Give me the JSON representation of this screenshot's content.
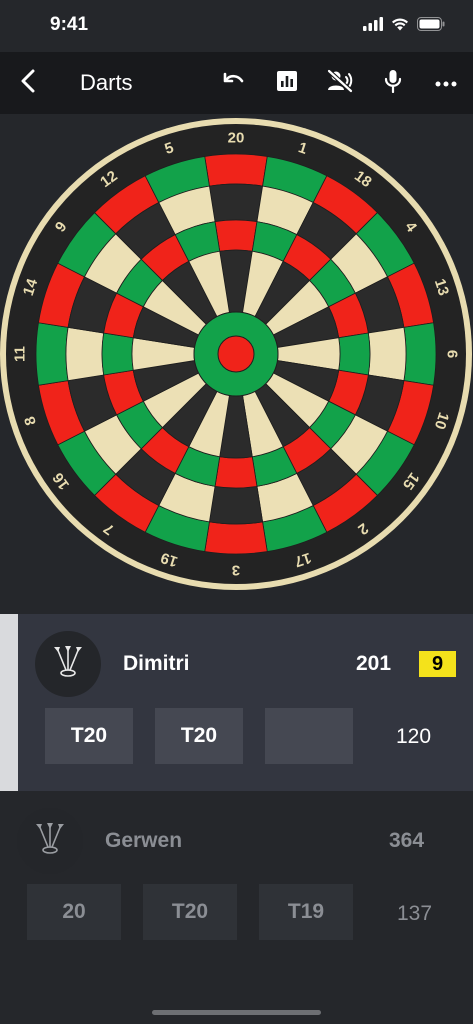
{
  "status": {
    "time": "9:41",
    "icons": [
      "signal-icon",
      "wifi-icon",
      "battery-icon"
    ]
  },
  "nav": {
    "title": "Darts",
    "icons": [
      "back-arrow-icon",
      "undo-icon",
      "stats-icon",
      "voice-off-icon",
      "microphone-icon",
      "more-icon"
    ]
  },
  "board": {
    "numbers": [
      "20",
      "1",
      "18",
      "4",
      "13",
      "6",
      "10",
      "15",
      "2",
      "17",
      "3",
      "19",
      "7",
      "16",
      "8",
      "11",
      "14",
      "9",
      "12",
      "5"
    ],
    "colors": {
      "black": "#2b2b2b",
      "cream": "#ece0b5",
      "red": "#f0231a",
      "green": "#12a24a",
      "rim": "#232323",
      "wire": "#e8dcb0",
      "numbers": "#e8dcb0"
    }
  },
  "players": [
    {
      "name": "Dimitri",
      "score": "201",
      "darts_left": "9",
      "active": true,
      "throws": [
        "T20",
        "T20",
        ""
      ],
      "turn_total": "120",
      "avatar_icon": "darts-icon"
    },
    {
      "name": "Gerwen",
      "score": "364",
      "active": false,
      "throws": [
        "20",
        "T20",
        "T19"
      ],
      "turn_total": "137",
      "avatar_icon": "darts-icon"
    }
  ],
  "colors": {
    "background": "#25272b",
    "nav_background": "#18191c",
    "active_card": "#333640",
    "active_strip": "#d9dadd",
    "badge": "#f4e21b",
    "inactive_text": "#8b8e94"
  }
}
